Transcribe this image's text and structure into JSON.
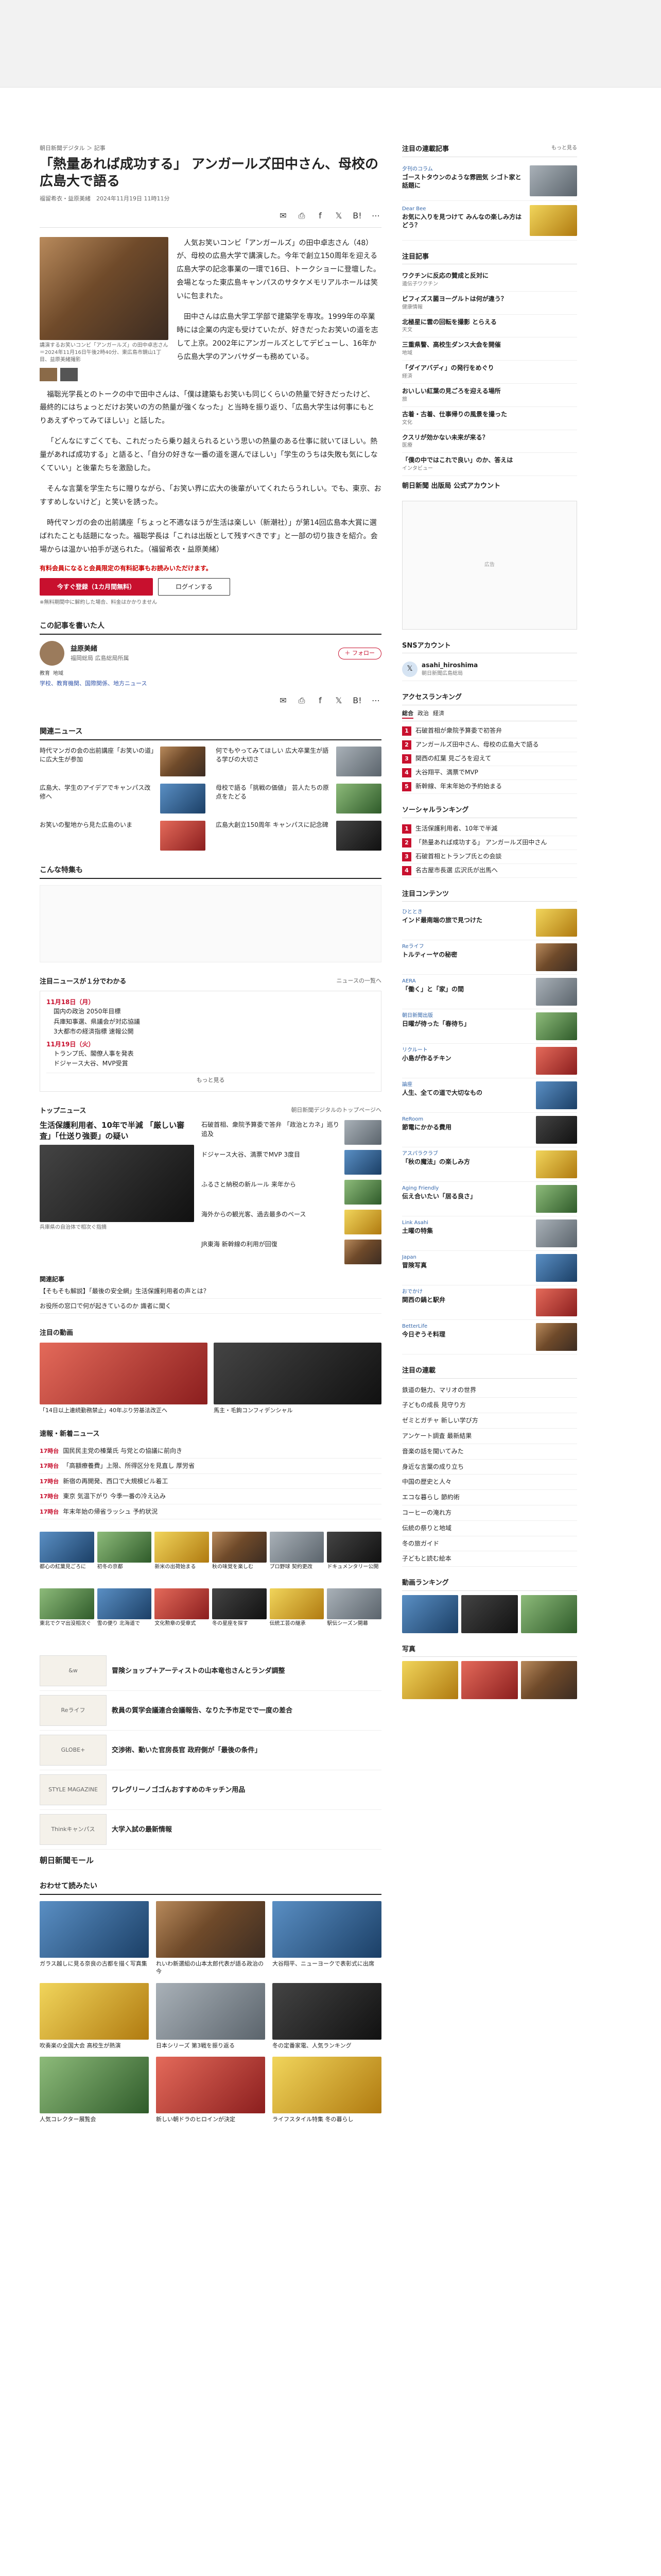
{
  "article": {
    "breadcrumb": "朝日新聞デジタル ＞ 記事",
    "title": "「熱量あれば成功する」 アンガールズ田中さん、母校の広島大で語る",
    "byline": "福留希衣・益原美緒　2024年11月19日 11時11分",
    "lead_caption": "講演するお笑いコンビ「アンガールズ」の田中卓志さん＝2024年11月16日午後2時40分、東広島市鏡山1丁目、益原美緒撮影",
    "paragraphs": [
      "人気お笑いコンビ「アンガールズ」の田中卓志さん（48）が、母校の広島大学で講演した。今年で創立150周年を迎える広島大学の記念事業の一環で16日、トークショーに登壇した。会場となった東広島キャンパスのサタケメモリアルホールは笑いに包まれた。",
      "田中さんは広島大学工学部で建築学を専攻。1999年の卒業時には企業の内定も受けていたが、好きだったお笑いの道を志して上京。2002年にアンガールズとしてデビューし、16年から広島大学のアンバサダーも務めている。",
      "福聡光学長とのトークの中で田中さんは、「僕は建築もお笑いも同じくらいの熱量で好きだったけど、最終的にはちょっとだけお笑いの方の熱量が強くなった」と当時を振り返り、「広島大学生は何事にもとりあえずやってみてほしい」と話した。",
      "「どんなにすごくても、これだったら乗り越えられるという思いの熱量のある仕事に就いてほしい。熱量があれば成功する」と語ると、「自分の好きな一番の道を選んでほしい」「学生のうちは失敗も気にしなくていい」と後輩たちを激励した。",
      "そんな言葉を学生たちに贈りながら、「お笑い界に広大の後輩がいてくれたらうれしい。でも、東京、おすすめしないけど」と笑いを誘った。",
      "時代マンガの会の出前講座「ちょっと不適なほうが生活は楽しい（新潮社）」が第14回広島本大賞に選ばれたことも話題になった。福聡学長は「これは出版として残すべきです」と一部の切り抜きを紹介。会場からは温かい拍手が送られた。（福留希衣・益原美緒）"
    ],
    "paywall_note": "有料会員になると会員限定の有料記事もお読みいただけます。",
    "cta_primary": "今すぐ登録（1カ月間無料）",
    "cta_secondary": "ログインする",
    "cta_note": "※無料期間中に解約した場合、料金はかかりません",
    "share_icons": [
      "mail-icon",
      "print-icon",
      "facebook-icon",
      "x-icon",
      "hatena-icon",
      "more-icon"
    ]
  },
  "writer": {
    "section_title": "この記事を書いた人",
    "name": "益原美緒",
    "role": "福岡総局 広島総局所属",
    "follow": "フォロー",
    "tags": [
      "教育",
      "地域"
    ],
    "tag_line": "学校、教育機関、国際関係、地方ニュース"
  },
  "related": {
    "title": "関連ニュース",
    "items": [
      {
        "text": "時代マンガの会の出前講座「お笑いの道」に広大生が参加"
      },
      {
        "text": "何でもやってみてほしい 広大卒業生が語る学びの大切さ"
      },
      {
        "text": "広島大、学生のアイデアでキャンパス改修へ"
      },
      {
        "text": "母校で語る「挑戦の価値」 芸人たちの原点をたどる"
      },
      {
        "text": "お笑いの聖地から見た広島のいま"
      },
      {
        "text": "広島大創立150周年 キャンパスに記念碑"
      }
    ],
    "special_title": "こんな特集も"
  },
  "timeline": {
    "title": "注目ニュースが１分でわかる",
    "more_label": "ニュースの一覧へ",
    "days": [
      {
        "date": "11月18日（月）",
        "items": [
          "国内の政治 2050年目標",
          "兵庫知事選、県議会が対応協議",
          "3大都市の経済指標 速報公開"
        ]
      },
      {
        "date": "11月19日（火）",
        "items": [
          "トランプ氏、閣僚人事を発表",
          "ドジャース大谷、MVP受賞"
        ]
      }
    ],
    "more": "もっと見る"
  },
  "top_news": {
    "title": "トップニュース",
    "note": "朝日新聞デジタルのトップページへ",
    "lead_title": "生活保護利用者、10年で半減 「厳しい審査」「仕送り強要」の疑い",
    "lead_sub": "兵庫県の自治体で相次ぐ指摘",
    "items": [
      "石破首相、衆院予算委で答弁 「政治とカネ」巡り追及",
      "ドジャース大谷、満票でMVP 3度目",
      "ふるさと納税の新ルール 来年から",
      "海外からの観光客、過去最多のペース",
      "JR東海 新幹線の利用が回復"
    ],
    "feature_title": "関連記事",
    "feature_items": [
      "【そもそも解説】「最後の安全網」生活保護利用者の声とは？",
      "お役所の窓口で何が起きているのか 識者に聞く"
    ]
  },
  "videos": {
    "title": "注目の動画",
    "items": [
      {
        "caption": "「14日以上連続勤務禁止」40年ぶり労基法改正へ"
      },
      {
        "caption": "馬主・毛鉤コンフィデンシャル"
      }
    ]
  },
  "latest": {
    "title": "速報・新着ニュース",
    "items": [
      {
        "time": "17時台",
        "text": "国民民主党の榛葉氏 与党との協議に前向き"
      },
      {
        "time": "17時台",
        "text": "「高額療養費」上限、所得区分を見直し 厚労省"
      },
      {
        "time": "17時台",
        "text": "新宿の再開発、西口で大規模ビル着工"
      },
      {
        "time": "17時台",
        "text": "東京 気温下がり 今季一番の冷え込み"
      },
      {
        "time": "17時台",
        "text": "年末年始の帰省ラッシュ 予約状況"
      }
    ]
  },
  "tiles": [
    "都心の紅葉見ごろに",
    "初冬の京都",
    "新米の出荷始まる",
    "秋の味覚を楽しむ",
    "プロ野球 契約更改",
    "ドキュメンタリー公開",
    "東北でクマ出没相次ぐ",
    "雪の便り 北海道で",
    "文化勲章の受章式",
    "冬の星座を探す",
    "伝統工芸の継承",
    "駅伝シーズン開幕"
  ],
  "promos": [
    {
      "logo": "&w",
      "text": "冒険ショップ＋アーティストの山本竜也さんとランダ調整"
    },
    {
      "logo": "Reライフ",
      "text": "教員の質学会議連合会議報告、なりた予市足でで一度の差合"
    },
    {
      "logo": "GLOBE+",
      "text": "交渉術、動いた官房長官 政府側が「最後の条件」"
    },
    {
      "logo": "STYLE MAGAZINE",
      "text": "ワレグリーノゴゴんおすすめのキッチン用品"
    },
    {
      "logo": "Thinkキャンパス",
      "text": "大学入試の最新情報"
    }
  ],
  "shop": {
    "title": "朝日新聞モール"
  },
  "recs": {
    "title": "おわせて読みたい",
    "items": [
      "ガラス越しに見る奈良の古都を描く写真集",
      "れいわ新選組の山本太郎代表が語る政治の今",
      "大谷翔平、ニューヨークで表彰式に出席",
      "吹奏楽の全国大会 高校生が熱演",
      "日本シリーズ 第3戦を振り返る",
      "冬の定番家電、人気ランキング",
      "人気コレクター展覧会",
      "新しい朝ドラのヒロインが決定",
      "ライフスタイル特集 冬の暮らし"
    ]
  },
  "sidebar": {
    "features_title": "注目の連載記事",
    "features_more": "もっと見る",
    "features": [
      {
        "label": "夕刊のコラム",
        "head": "ゴーストタウンのような雰囲気 シゴト家と話題に"
      },
      {
        "label": "Dear Bee",
        "head": "お気に入りを見つけて みんなの楽しみ方はどう？"
      }
    ],
    "list_title": "注目記事",
    "list": [
      {
        "t": "ワクチンに反応の賛成と反対に",
        "s": "遺伝子ワクチン"
      },
      {
        "t": "ビフィズス菌ヨーグルトは何が違う？",
        "s": "健康情報"
      },
      {
        "t": "北極星に雲の回転を撮影 とらえる",
        "s": "天文"
      },
      {
        "t": "三重県警、高校生ダンス大会を開催",
        "s": "地域"
      },
      {
        "t": "「ダイアバディ」の発行をめぐり",
        "s": "経済"
      },
      {
        "t": "おいしい紅葉の見ごろを迎える場所",
        "s": "旅"
      },
      {
        "t": "古着・古着、仕事帰りの風景を撮った",
        "s": "文化"
      },
      {
        "t": "クスリが効かない未来が来る？",
        "s": "医療"
      },
      {
        "t": "「僕の中ではこれで良い」のか、答えは",
        "s": "インタビュー"
      }
    ],
    "account_title": "朝日新聞 出版局 公式アカウント",
    "ad_label": "広告",
    "sns_title": "SNSアカウント",
    "sns": [
      {
        "name": "asahi_hiroshima",
        "sub": "朝日新聞広島総局"
      }
    ],
    "ranking_title": "アクセスランキング",
    "ranking_tabs": [
      "総合",
      "政治",
      "経済"
    ],
    "ranking": [
      "石破首相が衆院予算委で初答弁",
      "アンガールズ田中さん、母校の広島大で語る",
      "関西の紅葉 見ごろを迎えて",
      "大谷翔平、満票でMVP",
      "新幹線、年末年始の予約始まる"
    ],
    "social_title": "ソーシャルランキング",
    "social_ranking": [
      "生活保護利用者、10年で半減",
      "「熱量あれば成功する」 アンガールズ田中さん",
      "石破首相とトランプ氏との会談",
      "名古屋市長選 広沢氏が出馬へ"
    ],
    "contents_title": "注目コンテンツ",
    "contents": [
      {
        "label": "ひととき",
        "text": "インド最南端の旅で見つけた"
      },
      {
        "label": "Reライフ",
        "text": "トルティーヤの秘密"
      },
      {
        "label": "AERA",
        "text": "「働く」と「家」の間"
      },
      {
        "label": "朝日新聞出版",
        "text": "日曜が待った「春待ち」"
      },
      {
        "label": "リクルート",
        "text": "小島が作るチキン"
      },
      {
        "label": "論座",
        "text": "人生、全ての道で大切なもの"
      },
      {
        "label": "ReRoom",
        "text": "節電にかかる費用"
      },
      {
        "label": "アスパラクラブ",
        "text": "「秋の魔法」の楽しみ方"
      },
      {
        "label": "Aging Friendly",
        "text": "伝え合いたい「居る良さ」"
      },
      {
        "label": "Link Asahi",
        "text": "土曜の特集"
      },
      {
        "label": "Japan",
        "text": "冒険写真"
      },
      {
        "label": "おでかけ",
        "text": "関西の鍋と駅弁"
      },
      {
        "label": "BetterLife",
        "text": "今日ぞうそ料理"
      }
    ],
    "topics_title": "注目の連載",
    "topics": [
      "鉄道の魅力、マリオの世界",
      "子どもの成長 見守り方",
      "ゼミとガチャ 新しい学び方",
      "アンケート調査 最新結果",
      "音楽の話を聞いてみた",
      "身近な言葉の成り立ち",
      "中国の歴史と人々",
      "エコな暮らし 節約術",
      "コーヒーの淹れ方",
      "伝統の祭りと地域",
      "冬の旅ガイド",
      "子どもと読む絵本"
    ],
    "video_title": "動画ランキング",
    "photo_title": "写真"
  }
}
